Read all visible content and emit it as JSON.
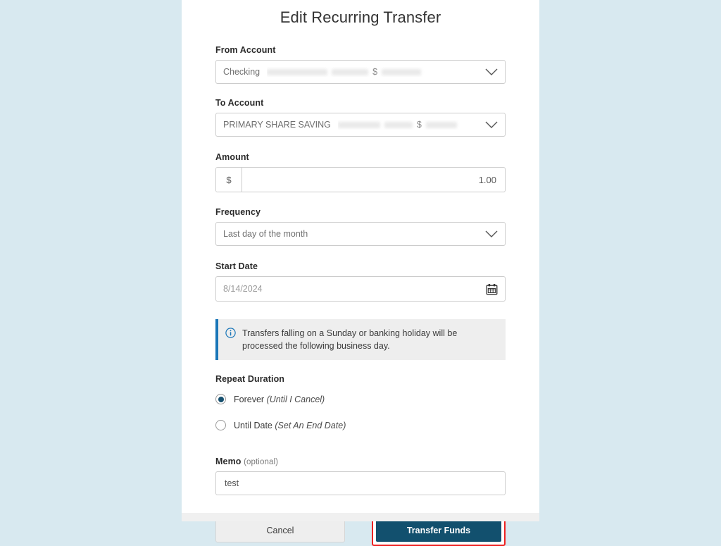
{
  "form": {
    "title": "Edit Recurring Transfer",
    "from_account": {
      "label": "From Account",
      "value": "Checking",
      "currency_symbol": "$",
      "masked": true
    },
    "to_account": {
      "label": "To Account",
      "value": "PRIMARY SHARE SAVING",
      "currency_symbol": "$",
      "masked": true
    },
    "amount": {
      "label": "Amount",
      "currency_symbol": "$",
      "value": "1.00"
    },
    "frequency": {
      "label": "Frequency",
      "value": "Last day of the month"
    },
    "start_date": {
      "label": "Start Date",
      "value": "8/14/2024",
      "icon": "calendar-icon"
    },
    "info_banner": {
      "icon": "info-circle-icon",
      "text": "Transfers falling on a Sunday or banking holiday will be processed the following business day.",
      "accent_color": "#1976b8"
    },
    "repeat_duration": {
      "label": "Repeat Duration",
      "options": [
        {
          "label": "Forever",
          "sub_label": "(Until I Cancel)",
          "selected": true
        },
        {
          "label": "Until Date",
          "sub_label": "(Set An End Date)",
          "selected": false
        }
      ]
    },
    "memo": {
      "label": "Memo",
      "optional_hint": "(optional)",
      "value": "test"
    },
    "actions": {
      "cancel_label": "Cancel",
      "submit_label": "Transfer Funds",
      "submit_color": "#12506e",
      "highlight_color": "#ee2222"
    }
  },
  "theme": {
    "page_background": "#d8e9f0",
    "card_background": "#ffffff"
  }
}
